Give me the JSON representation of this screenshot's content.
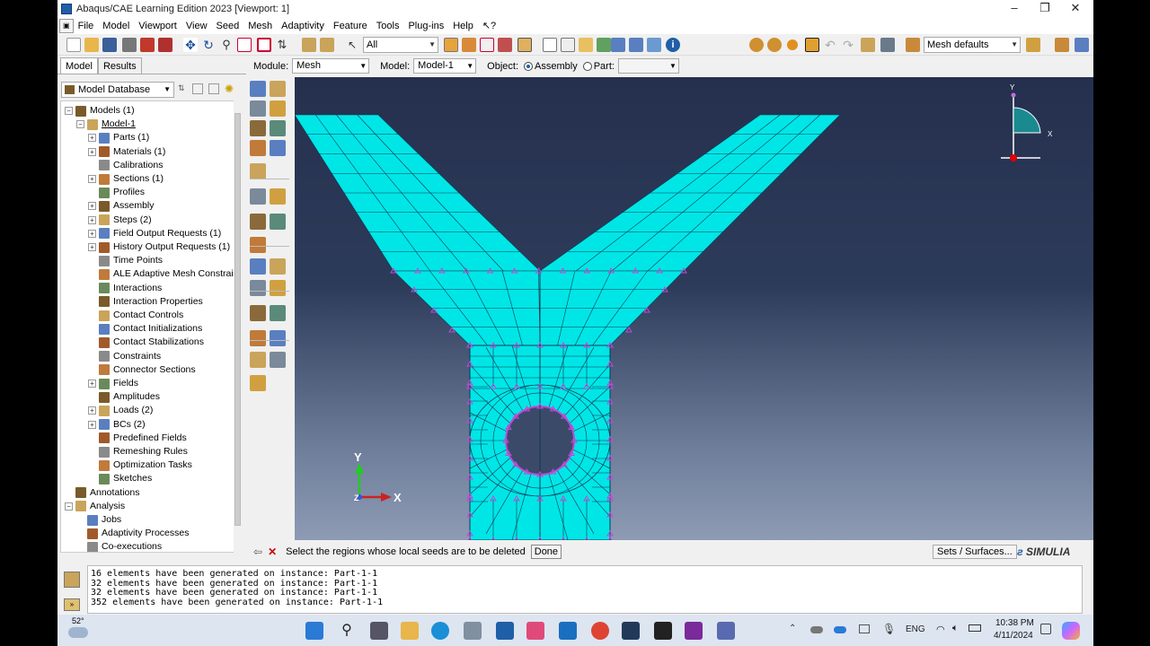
{
  "window": {
    "title": "Abaqus/CAE Learning Edition 2023 [Viewport: 1]",
    "minimize": "–",
    "maximize": "❐",
    "close": "✕"
  },
  "menu": [
    "File",
    "Model",
    "Viewport",
    "View",
    "Seed",
    "Mesh",
    "Adaptivity",
    "Feature",
    "Tools",
    "Plug-ins",
    "Help",
    "↖?"
  ],
  "toolbar": {
    "select_filter": "All",
    "mesh_defaults": "Mesh defaults"
  },
  "context": {
    "module_label": "Module:",
    "module": "Mesh",
    "model_label": "Model:",
    "model": "Model-1",
    "object_label": "Object:",
    "assembly": "Assembly",
    "part": "Part:",
    "part_value": ""
  },
  "tabs": [
    "Model",
    "Results"
  ],
  "model_db": "Model Database",
  "tree": [
    {
      "label": "Models (1)",
      "level": 0,
      "exp": "−"
    },
    {
      "label": "Model-1",
      "level": 1,
      "exp": "−",
      "underline": true
    },
    {
      "label": "Parts (1)",
      "level": 2,
      "exp": "+"
    },
    {
      "label": "Materials (1)",
      "level": 2,
      "exp": "+"
    },
    {
      "label": "Calibrations",
      "level": 2,
      "exp": ""
    },
    {
      "label": "Sections (1)",
      "level": 2,
      "exp": "+"
    },
    {
      "label": "Profiles",
      "level": 2,
      "exp": ""
    },
    {
      "label": "Assembly",
      "level": 2,
      "exp": "+"
    },
    {
      "label": "Steps (2)",
      "level": 2,
      "exp": "+"
    },
    {
      "label": "Field Output Requests (1)",
      "level": 2,
      "exp": "+"
    },
    {
      "label": "History Output Requests (1)",
      "level": 2,
      "exp": "+"
    },
    {
      "label": "Time Points",
      "level": 2,
      "exp": ""
    },
    {
      "label": "ALE Adaptive Mesh Constraints",
      "level": 2,
      "exp": ""
    },
    {
      "label": "Interactions",
      "level": 2,
      "exp": ""
    },
    {
      "label": "Interaction Properties",
      "level": 2,
      "exp": ""
    },
    {
      "label": "Contact Controls",
      "level": 2,
      "exp": ""
    },
    {
      "label": "Contact Initializations",
      "level": 2,
      "exp": ""
    },
    {
      "label": "Contact Stabilizations",
      "level": 2,
      "exp": ""
    },
    {
      "label": "Constraints",
      "level": 2,
      "exp": ""
    },
    {
      "label": "Connector Sections",
      "level": 2,
      "exp": ""
    },
    {
      "label": "Fields",
      "level": 2,
      "exp": "+"
    },
    {
      "label": "Amplitudes",
      "level": 2,
      "exp": ""
    },
    {
      "label": "Loads (2)",
      "level": 2,
      "exp": "+"
    },
    {
      "label": "BCs (2)",
      "level": 2,
      "exp": "+"
    },
    {
      "label": "Predefined Fields",
      "level": 2,
      "exp": ""
    },
    {
      "label": "Remeshing Rules",
      "level": 2,
      "exp": ""
    },
    {
      "label": "Optimization Tasks",
      "level": 2,
      "exp": ""
    },
    {
      "label": "Sketches",
      "level": 2,
      "exp": ""
    },
    {
      "label": "Annotations",
      "level": 0,
      "exp": ""
    },
    {
      "label": "Analysis",
      "level": 0,
      "exp": "−"
    },
    {
      "label": "Jobs",
      "level": 1,
      "exp": ""
    },
    {
      "label": "Adaptivity Processes",
      "level": 1,
      "exp": ""
    },
    {
      "label": "Co-executions",
      "level": 1,
      "exp": ""
    }
  ],
  "prompt": {
    "text": "Select the regions whose local seeds are to be deleted",
    "done": "Done",
    "sets": "Sets / Surfaces..."
  },
  "brand": "SIMULIA",
  "triad": {
    "y": "Y",
    "x": "X",
    "z": "Z"
  },
  "messages": [
    "16 elements have been generated on instance: Part-1-1",
    "32 elements have been generated on instance: Part-1-1",
    "32 elements have been generated on instance: Part-1-1",
    "352 elements have been generated on instance: Part-1-1"
  ],
  "taskbar": {
    "weather": "52°",
    "lang": "ENG",
    "time": "10:38 PM",
    "date": "4/11/2024"
  },
  "colors": {
    "mesh": "#00e6e6",
    "mesh_line": "#0d3b55",
    "seed": "#c04bd6",
    "accent": "#1f5fa8"
  }
}
